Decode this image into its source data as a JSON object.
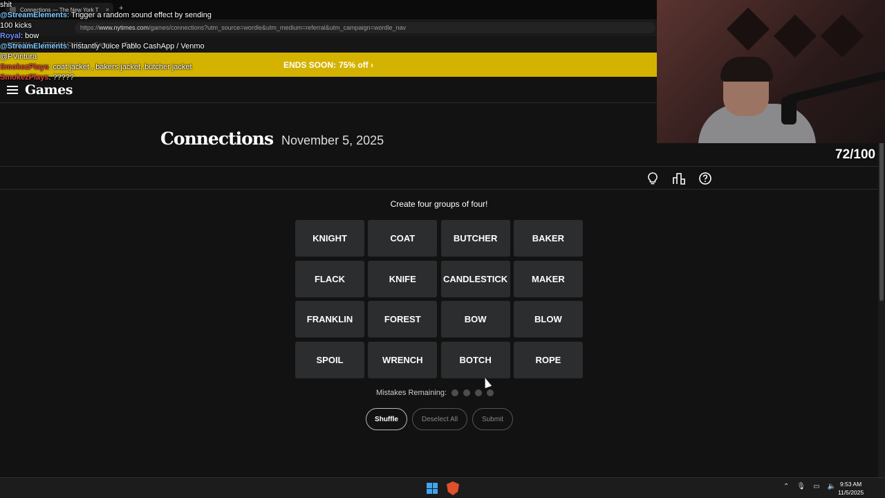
{
  "browser": {
    "tab_title": "Connections — The New York T",
    "tab_close": "×",
    "new_tab": "+",
    "url_prefix": "https://",
    "url_domain": "www.nytimes.com",
    "url_path": "/games/connections?utm_source=wordle&utm_medium=referral&utm_campaign=wordle_nav",
    "bookmarks": [
      "STREAM",
      "STREAM CHAT",
      "Games",
      "Tools"
    ]
  },
  "banner": {
    "label": "ENDS SOON:",
    "offer": " 75% off ›",
    "color": "#d4b300"
  },
  "header": {
    "logo": "Games"
  },
  "puzzle": {
    "title": "Connections",
    "date": "November 5, 2025",
    "instruction": "Create four groups of four!",
    "words": [
      "KNIGHT",
      "COAT",
      "BUTCHER",
      "BAKER",
      "FLACK",
      "KNIFE",
      "CANDLESTICK",
      "MAKER",
      "FRANKLIN",
      "FOREST",
      "BOW",
      "BLOW",
      "SPOIL",
      "WRENCH",
      "BOTCH",
      "ROPE"
    ],
    "mistakes_label": "Mistakes Remaining:",
    "mistakes_remaining": 4,
    "shuffle": "Shuffle",
    "deselect": "Deselect All",
    "submit": "Submit"
  },
  "toolbar_icons": [
    "hint-bulb-icon",
    "stats-icon",
    "help-icon"
  ],
  "chat": [
    {
      "user": "",
      "text": "shit"
    },
    {
      "user": "@StreamElements",
      "text": ": Trigger a random sound effect by sending 100 kicks"
    },
    {
      "user": "Royal",
      "text": ": bow"
    },
    {
      "user": "@StreamElements",
      "text": ": Instantly Juice Pablo CashApp / Venmo @PVintura"
    },
    {
      "user": "SmokezPlays",
      "text": ": coat jacket , bakers jacket, butcher jacket"
    },
    {
      "user": "SmokezPlays",
      "text": ": ?????"
    }
  ],
  "stream_goal": "72/100",
  "taskbar": {
    "time": "9:53 AM",
    "date": "11/5/2025"
  }
}
